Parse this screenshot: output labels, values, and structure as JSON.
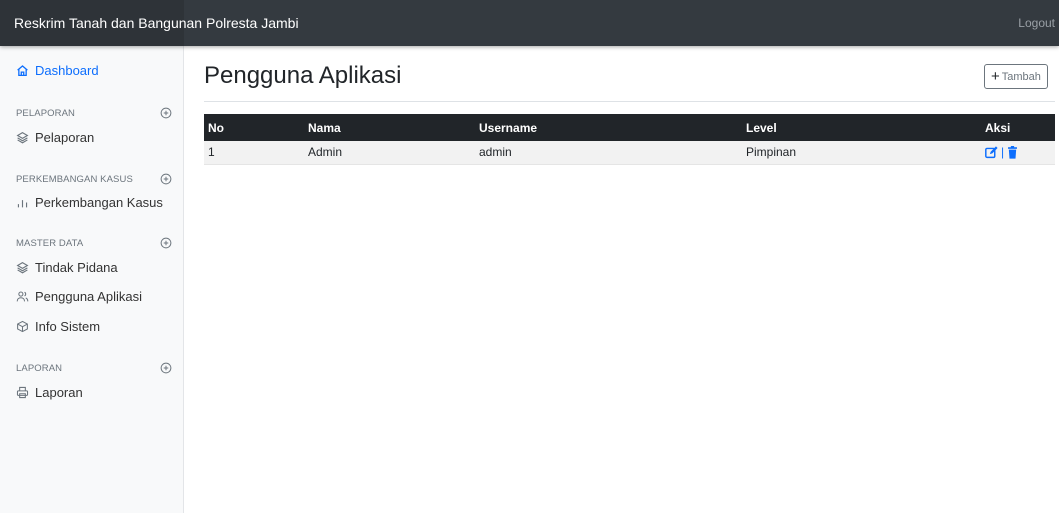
{
  "topbar": {
    "brand": "Reskrim Tanah dan Bangunan Polresta Jambi",
    "logout": "Logout"
  },
  "sidebar": {
    "dashboard": "Dashboard",
    "sections": [
      {
        "heading": "PELAPORAN",
        "items": [
          "Pelaporan"
        ]
      },
      {
        "heading": "PERKEMBANGAN KASUS",
        "items": [
          "Perkembangan Kasus"
        ]
      },
      {
        "heading": "MASTER DATA",
        "items": [
          "Tindak Pidana",
          "Pengguna Aplikasi",
          "Info Sistem"
        ]
      },
      {
        "heading": "LAPORAN",
        "items": [
          "Laporan"
        ]
      }
    ]
  },
  "main": {
    "title": "Pengguna Aplikasi",
    "add_button": "Tambah",
    "table": {
      "headers": [
        "No",
        "Nama",
        "Username",
        "Level",
        "Aksi"
      ],
      "rows": [
        {
          "no": "1",
          "nama": "Admin",
          "username": "admin",
          "level": "Pimpinan",
          "separator": "|"
        }
      ]
    }
  },
  "colors": {
    "topbar": "#343a40",
    "accent": "#0d6efd",
    "table_header": "#212529"
  }
}
